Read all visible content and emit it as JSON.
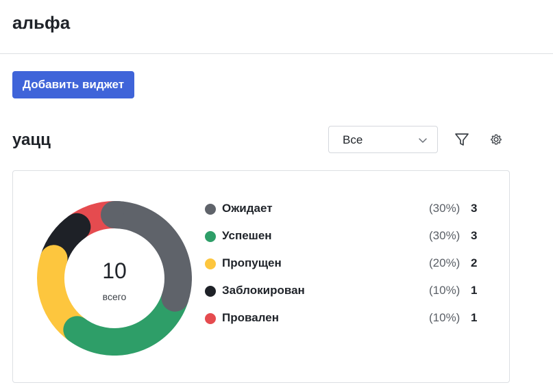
{
  "header": {
    "title": "альфа"
  },
  "toolbar": {
    "add_widget_label": "Добавить виджет"
  },
  "widget": {
    "title": "уацц",
    "filter_select": {
      "value": "Все"
    },
    "total": "10",
    "total_caption": "всего",
    "legend": [
      {
        "label": "Ожидает",
        "percent": "(30%)",
        "count": "3",
        "color": "#5f636a"
      },
      {
        "label": "Успешен",
        "percent": "(30%)",
        "count": "3",
        "color": "#2e9e68"
      },
      {
        "label": "Пропущен",
        "percent": "(20%)",
        "count": "2",
        "color": "#fdc63e"
      },
      {
        "label": "Заблокирован",
        "percent": "(10%)",
        "count": "1",
        "color": "#1e2127"
      },
      {
        "label": "Провален",
        "percent": "(10%)",
        "count": "1",
        "color": "#e54b4f"
      }
    ]
  },
  "icons": {
    "select_chevron": "chevron-down-icon",
    "filter": "filter-icon",
    "settings": "gear-icon"
  },
  "colors": {
    "accent": "#3f64d9",
    "border": "#dcdfe3"
  }
}
